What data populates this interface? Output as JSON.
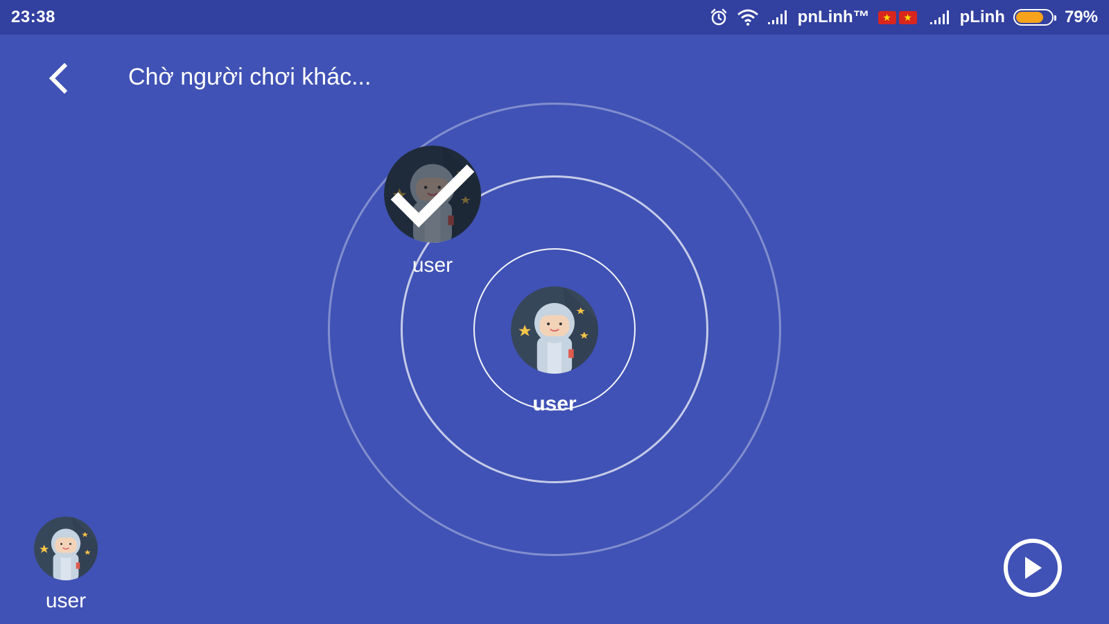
{
  "status_bar": {
    "time": "23:38",
    "carrier_1": "pnLinh™",
    "carrier_2": "pLinh",
    "battery_percent": "79%",
    "battery_level": 0.79,
    "icons": [
      "alarm-icon",
      "wifi-icon",
      "signal-icon",
      "vietnam-flag-icon",
      "signal-icon",
      "battery-icon"
    ]
  },
  "header": {
    "title": "Chờ người chơi khác..."
  },
  "players": {
    "center": {
      "name": "user"
    },
    "joined": {
      "name": "user",
      "ready": true
    },
    "self": {
      "name": "user"
    }
  },
  "colors": {
    "background": "#4052b5",
    "status_bar": "#3240a0",
    "avatar_bg": "#37475a",
    "accent_star": "#f7c548",
    "battery": "#f6a21a"
  }
}
